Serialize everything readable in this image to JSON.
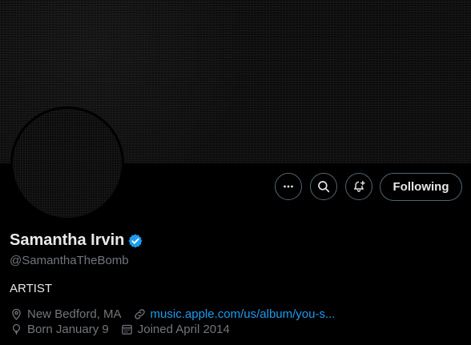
{
  "profile": {
    "name": "Samantha Irvin",
    "handle": "@SamanthaTheBomb",
    "bio": "ARTIST",
    "location": "New Bedford, MA",
    "website": "music.apple.com/us/album/you-s...",
    "birthday": "Born January 9",
    "joined": "Joined April 2014"
  },
  "actions": {
    "more_icon": "more-horizontal-icon",
    "search_icon": "search-icon",
    "notify_icon": "bell-plus-icon",
    "following_label": "Following"
  },
  "colors": {
    "background": "#000000",
    "text_primary": "#e7e9ea",
    "text_secondary": "#71767b",
    "link": "#1d9bf0",
    "verified": "#1d9bf0",
    "button_border": "#536471"
  }
}
